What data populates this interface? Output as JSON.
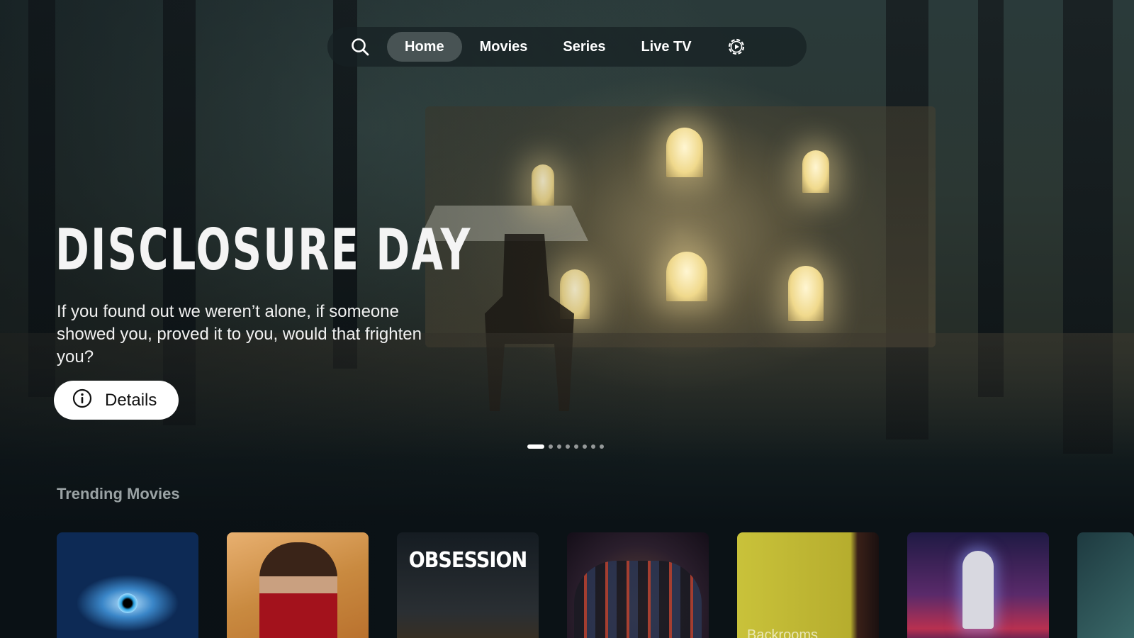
{
  "nav": {
    "search_icon": "search-icon",
    "settings_icon": "gear-icon",
    "items": [
      {
        "label": "Home",
        "active": true
      },
      {
        "label": "Movies",
        "active": false
      },
      {
        "label": "Series",
        "active": false
      },
      {
        "label": "Live TV",
        "active": false
      }
    ]
  },
  "hero": {
    "title": "DISCLOSURE DAY",
    "tagline": "If you found out we weren’t alone, if someone showed you, proved it to you, would that frighten you?",
    "details_label": "Details",
    "details_icon": "info-icon",
    "pager": {
      "count": 8,
      "active_index": 0
    }
  },
  "trending": {
    "title": "Trending Movies",
    "posters": [
      {
        "text": ""
      },
      {
        "text": ""
      },
      {
        "text": "OBSESSION"
      },
      {
        "text": ""
      },
      {
        "text": "Backrooms"
      },
      {
        "text": ""
      },
      {
        "text": ""
      }
    ]
  },
  "colors": {
    "background": "#0b1216",
    "nav_bg": "#162022",
    "button_bg": "#ffffff",
    "row_title": "#9aa2a4"
  }
}
